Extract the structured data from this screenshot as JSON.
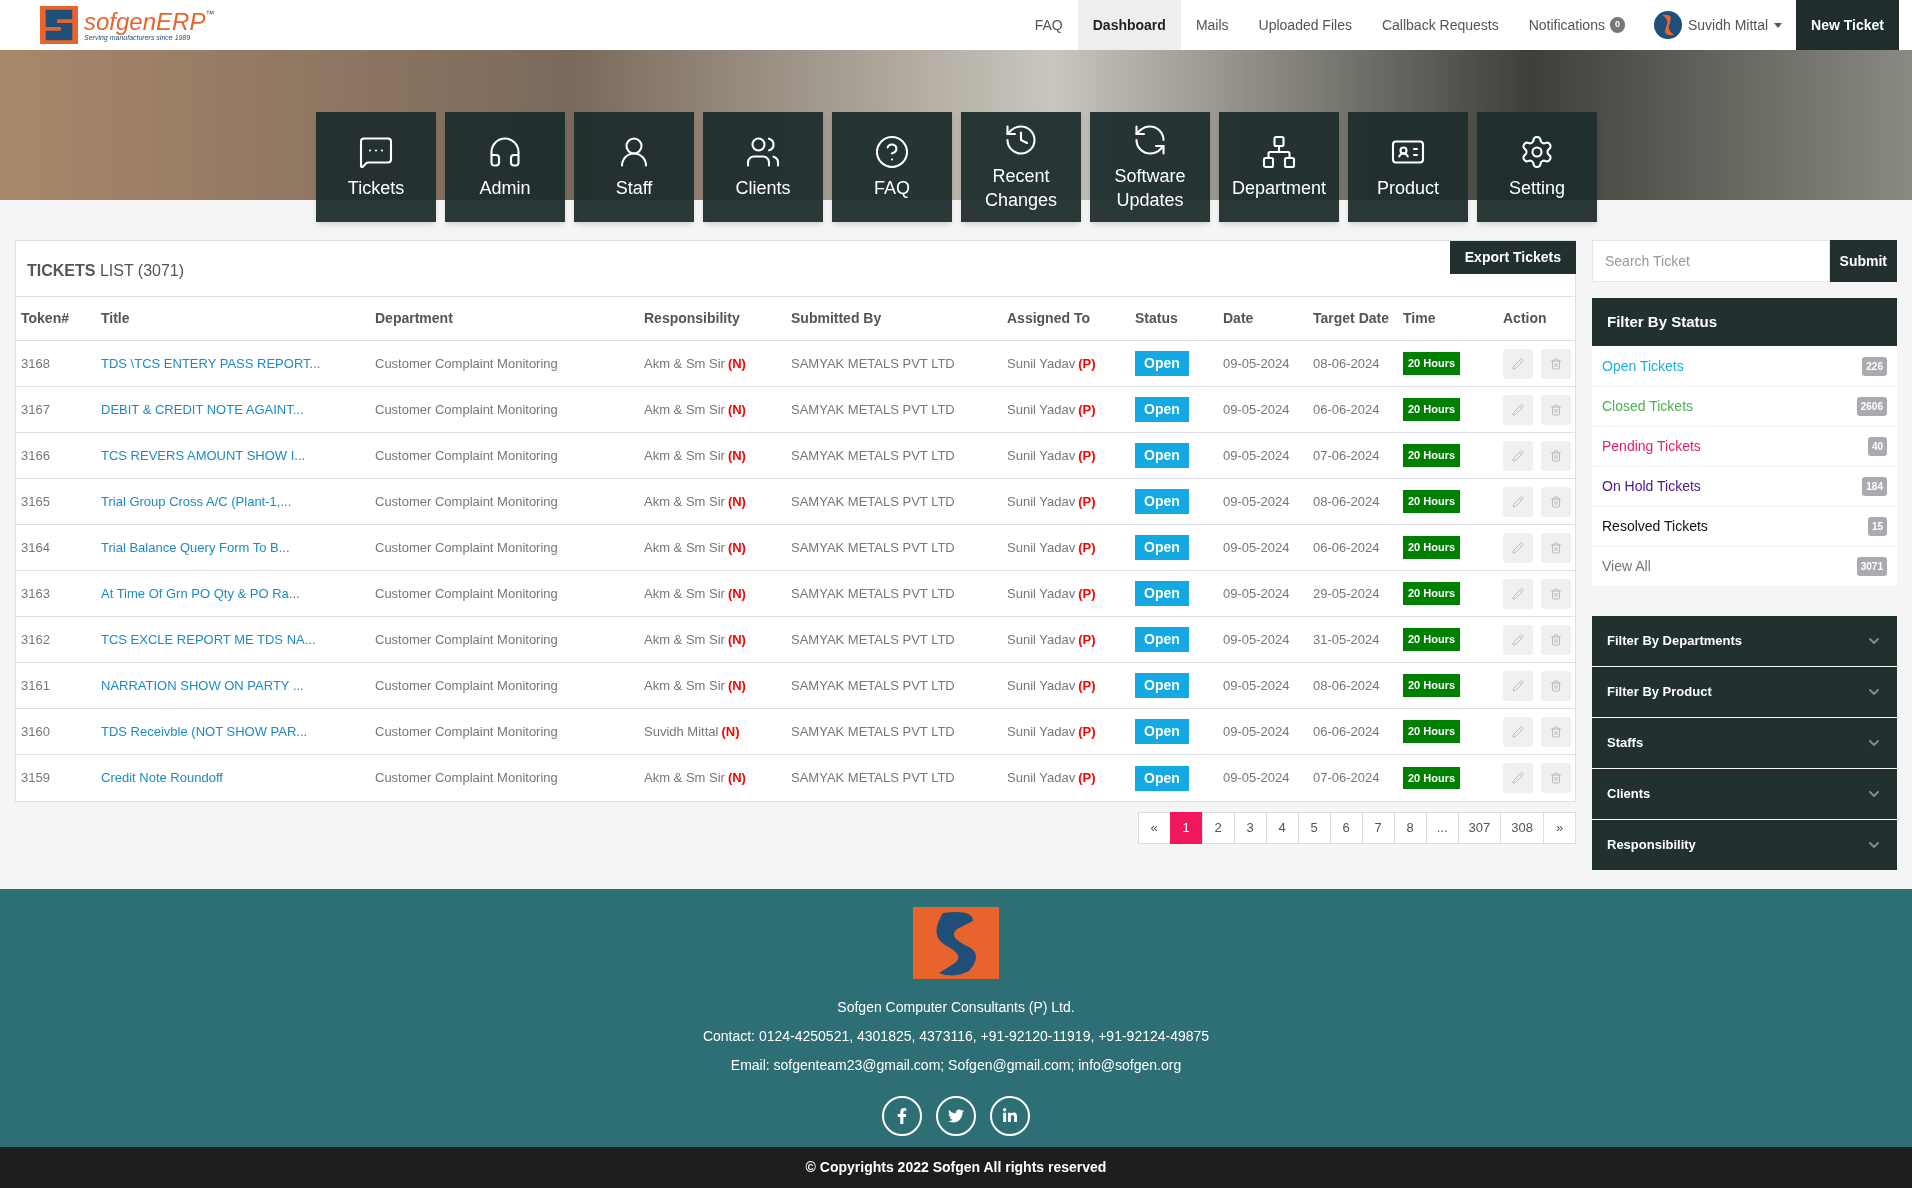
{
  "logo": {
    "name": "sofgenERP",
    "trademark": "™",
    "tagline": "Serving manufacturers since 1989"
  },
  "nav": [
    {
      "label": "FAQ",
      "selected": false
    },
    {
      "label": "Dashboard",
      "selected": true
    },
    {
      "label": "Mails",
      "selected": false
    },
    {
      "label": "Uploaded Files",
      "selected": false
    },
    {
      "label": "Callback Requests",
      "selected": false
    },
    {
      "label": "Notifications",
      "selected": false,
      "badge": "0"
    }
  ],
  "user": {
    "name": "Suvidh Mittal"
  },
  "new_ticket_button": "New Ticket",
  "tiles": [
    {
      "label": "Tickets"
    },
    {
      "label": "Admin"
    },
    {
      "label": "Staff"
    },
    {
      "label": "Clients"
    },
    {
      "label": "FAQ"
    },
    {
      "label": "Recent Changes"
    },
    {
      "label": "Software Updates"
    },
    {
      "label": "Department"
    },
    {
      "label": "Product"
    },
    {
      "label": "Setting"
    }
  ],
  "tickets": {
    "title": "**TICKETS** LIST (3071)",
    "export_button": "Export Tickets",
    "columns": [
      "Token#",
      "Title",
      "Department",
      "Responsibility",
      "Submitted By",
      "Assigned To",
      "Status",
      "Date",
      "Target Date",
      "Time",
      "Action"
    ],
    "rows": [
      {
        "token": "3168",
        "title": "TDS \\TCS ENTERY PASS REPORT...",
        "department": "Customer Complaint Monitoring",
        "responsibility": "Akm & Sm Sir",
        "responsibility_tag": "(N)",
        "submitted_by": "SAMYAK METALS PVT LTD",
        "assigned_to": "Sunil Yadav",
        "assigned_tag": "(P)",
        "status": "Open",
        "date": "09-05-2024",
        "target_date": "08-06-2024",
        "time": "20 Hours"
      },
      {
        "token": "3167",
        "title": "DEBIT & CREDIT NOTE AGAINT...",
        "department": "Customer Complaint Monitoring",
        "responsibility": "Akm & Sm Sir",
        "responsibility_tag": "(N)",
        "submitted_by": "SAMYAK METALS PVT LTD",
        "assigned_to": "Sunil Yadav",
        "assigned_tag": "(P)",
        "status": "Open",
        "date": "09-05-2024",
        "target_date": "06-06-2024",
        "time": "20 Hours"
      },
      {
        "token": "3166",
        "title": "TCS REVERS AMOUNT SHOW I...",
        "department": "Customer Complaint Monitoring",
        "responsibility": "Akm & Sm Sir",
        "responsibility_tag": "(N)",
        "submitted_by": "SAMYAK METALS PVT LTD",
        "assigned_to": "Sunil Yadav",
        "assigned_tag": "(P)",
        "status": "Open",
        "date": "09-05-2024",
        "target_date": "07-06-2024",
        "time": "20 Hours"
      },
      {
        "token": "3165",
        "title": "Trial Group Cross A/C (Plant-1,...",
        "department": "Customer Complaint Monitoring",
        "responsibility": "Akm & Sm Sir",
        "responsibility_tag": "(N)",
        "submitted_by": "SAMYAK METALS PVT LTD",
        "assigned_to": "Sunil Yadav",
        "assigned_tag": "(P)",
        "status": "Open",
        "date": "09-05-2024",
        "target_date": "08-06-2024",
        "time": "20 Hours"
      },
      {
        "token": "3164",
        "title": "Trial Balance Query Form To B...",
        "department": "Customer Complaint Monitoring",
        "responsibility": "Akm & Sm Sir",
        "responsibility_tag": "(N)",
        "submitted_by": "SAMYAK METALS PVT LTD",
        "assigned_to": "Sunil Yadav",
        "assigned_tag": "(P)",
        "status": "Open",
        "date": "09-05-2024",
        "target_date": "06-06-2024",
        "time": "20 Hours"
      },
      {
        "token": "3163",
        "title": "At Time Of Grn PO Qty & PO Ra...",
        "department": "Customer Complaint Monitoring",
        "responsibility": "Akm & Sm Sir",
        "responsibility_tag": "(N)",
        "submitted_by": "SAMYAK METALS PVT LTD",
        "assigned_to": "Sunil Yadav",
        "assigned_tag": "(P)",
        "status": "Open",
        "date": "09-05-2024",
        "target_date": "29-05-2024",
        "time": "20 Hours"
      },
      {
        "token": "3162",
        "title": "TCS EXCLE REPORT ME TDS NA...",
        "department": "Customer Complaint Monitoring",
        "responsibility": "Akm & Sm Sir",
        "responsibility_tag": "(N)",
        "submitted_by": "SAMYAK METALS PVT LTD",
        "assigned_to": "Sunil Yadav",
        "assigned_tag": "(P)",
        "status": "Open",
        "date": "09-05-2024",
        "target_date": "31-05-2024",
        "time": "20 Hours"
      },
      {
        "token": "3161",
        "title": "NARRATION SHOW ON PARTY ...",
        "department": "Customer Complaint Monitoring",
        "responsibility": "Akm & Sm Sir",
        "responsibility_tag": "(N)",
        "submitted_by": "SAMYAK METALS PVT LTD",
        "assigned_to": "Sunil Yadav",
        "assigned_tag": "(P)",
        "status": "Open",
        "date": "09-05-2024",
        "target_date": "08-06-2024",
        "time": "20 Hours"
      },
      {
        "token": "3160",
        "title": "TDS Receivble (NOT SHOW PAR...",
        "department": "Customer Complaint Monitoring",
        "responsibility": "Suvidh Mittal",
        "responsibility_tag": "(N)",
        "submitted_by": "SAMYAK METALS PVT LTD",
        "assigned_to": "Sunil Yadav",
        "assigned_tag": "(P)",
        "status": "Open",
        "date": "09-05-2024",
        "target_date": "06-06-2024",
        "time": "20 Hours"
      },
      {
        "token": "3159",
        "title": "Credit Note Roundoff",
        "department": "Customer Complaint Monitoring",
        "responsibility": "Akm & Sm Sir",
        "responsibility_tag": "(N)",
        "submitted_by": "SAMYAK METALS PVT LTD",
        "assigned_to": "Sunil Yadav",
        "assigned_tag": "(P)",
        "status": "Open",
        "date": "09-05-2024",
        "target_date": "07-06-2024",
        "time": "20 Hours"
      }
    ],
    "pagination": [
      {
        "label": "«",
        "selected": false
      },
      {
        "label": "1",
        "selected": true
      },
      {
        "label": "2",
        "selected": false
      },
      {
        "label": "3",
        "selected": false
      },
      {
        "label": "4",
        "selected": false
      },
      {
        "label": "5",
        "selected": false
      },
      {
        "label": "6",
        "selected": false
      },
      {
        "label": "7",
        "selected": false
      },
      {
        "label": "8",
        "selected": false
      },
      {
        "label": "...",
        "selected": false
      },
      {
        "label": "307",
        "selected": false
      },
      {
        "label": "308",
        "selected": false
      },
      {
        "label": "»",
        "selected": false
      }
    ]
  },
  "search": {
    "placeholder": "Search Ticket",
    "button": "Submit"
  },
  "status_filter": {
    "title": "Filter By Status",
    "items": [
      {
        "label": "Open Tickets",
        "count": "226",
        "color": "#1ab0e8"
      },
      {
        "label": "Closed Tickets",
        "count": "2606",
        "color": "#4caf50"
      },
      {
        "label": "Pending Tickets",
        "count": "40",
        "color": "#e91e63"
      },
      {
        "label": "On Hold Tickets",
        "count": "184",
        "color": "#4a148c"
      },
      {
        "label": "Resolved Tickets",
        "count": "15",
        "color": "#111111"
      },
      {
        "label": "View All",
        "count": "3071",
        "color": "#777777"
      }
    ]
  },
  "filters": [
    {
      "label": "Filter By Departments",
      "expanded": false
    },
    {
      "label": "Filter By Product",
      "expanded": false
    },
    {
      "label": "Staffs",
      "expanded": false
    },
    {
      "label": "Clients",
      "expanded": false
    },
    {
      "label": "Responsibility",
      "expanded": false
    }
  ],
  "footer": {
    "company": "Sofgen Computer Consultants (P) Ltd.",
    "contact": "Contact: 0124-4250521, 4301825, 4373116, +91-92120-11919, +91-92124-49875",
    "email": "Email: sofgenteam23@gmail.com; Sofgen@gmail.com; info@sofgen.org",
    "copyright": "© Copyrights 2022 Sofgen All rights reserved"
  }
}
